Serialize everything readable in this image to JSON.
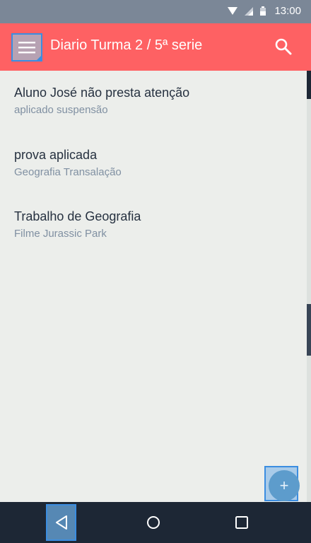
{
  "status_bar": {
    "time": "13:00",
    "icons": [
      "wifi-icon",
      "signal-icon",
      "battery-icon"
    ]
  },
  "app_bar": {
    "title": "Diario Turma 2 / 5ª serie",
    "menu_icon": "hamburger-menu-icon",
    "search_icon": "search-icon",
    "color": "#fe6163"
  },
  "list": {
    "items": [
      {
        "title": "Aluno José não presta atenção",
        "subtitle": "aplicado suspensão"
      },
      {
        "title": "prova aplicada",
        "subtitle": "Geografia Transalação"
      },
      {
        "title": "Trabalho de Geografia",
        "subtitle": "Filme Jurassic Park"
      }
    ]
  },
  "fab": {
    "icon": "add-icon",
    "label": "+"
  },
  "nav_bar": {
    "icons": [
      "back-icon",
      "home-icon",
      "recents-icon"
    ]
  }
}
